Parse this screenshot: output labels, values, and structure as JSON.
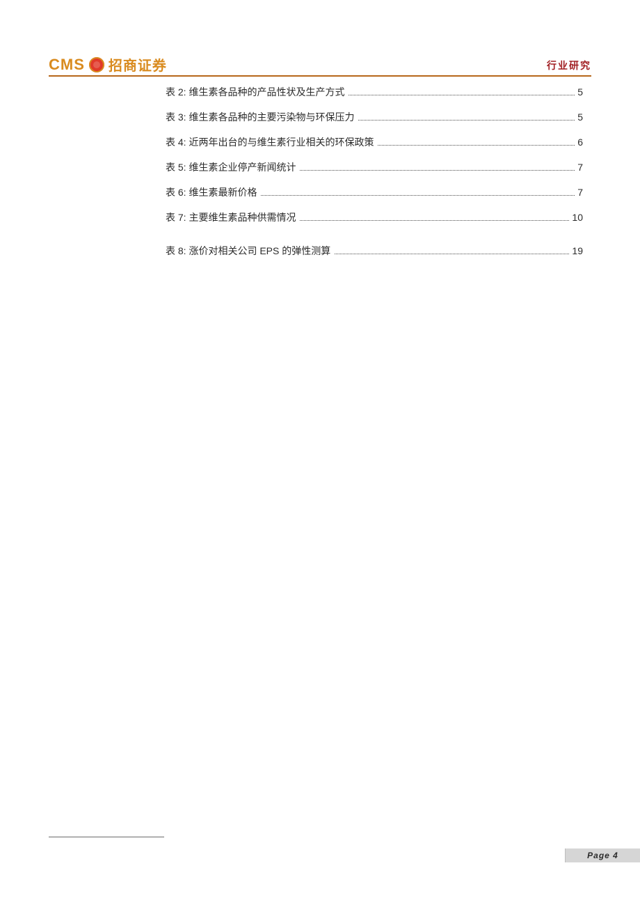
{
  "header": {
    "logo_latin": "CMS",
    "logo_cn": "招商证券",
    "right_label": "行业研究"
  },
  "toc": [
    {
      "label": "表 2:  维生素各品种的产品性状及生产方式",
      "page": "5"
    },
    {
      "label": "表 3:  维生素各品种的主要污染物与环保压力",
      "page": "5"
    },
    {
      "label": "表 4:  近两年出台的与维生素行业相关的环保政策",
      "page": "6"
    },
    {
      "label": "表 5:  维生素企业停产新闻统计",
      "page": "7"
    },
    {
      "label": "表 6:  维生素最新价格",
      "page": "7"
    },
    {
      "label": "表 7:  主要维生素品种供需情况",
      "page": "10"
    },
    {
      "label": "表 8:  涨价对相关公司 EPS 的弹性测算",
      "page": "19"
    }
  ],
  "footer": {
    "page_label": "Page 4"
  }
}
